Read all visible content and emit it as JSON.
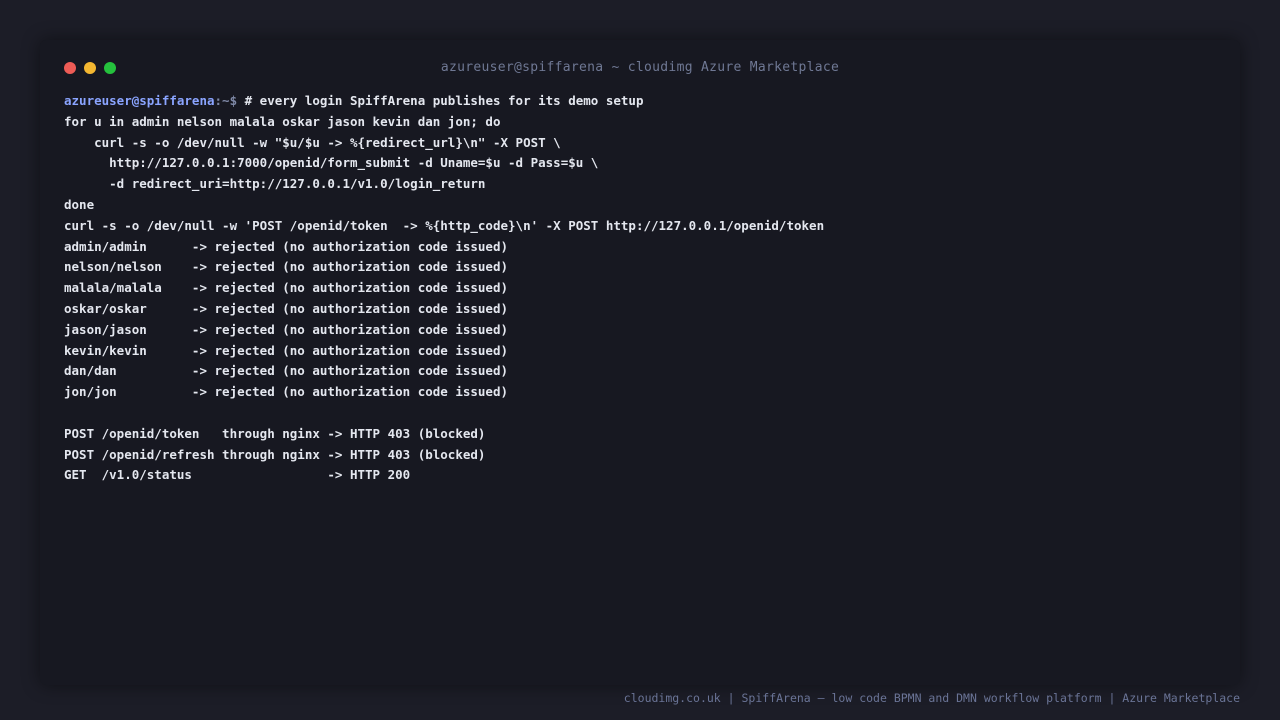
{
  "window": {
    "title": "azureuser@spiffarena ~ cloudimg Azure Marketplace",
    "controls": {
      "close_color": "#ee5c56",
      "minimize_color": "#f4b731",
      "maximize_color": "#25c13d"
    }
  },
  "terminal": {
    "prompt_user": "azureuser@spiffarena",
    "prompt_path": ":~$",
    "prompt_command": " # every login SpiffArena publishes for its demo setup",
    "lines": [
      "for u in admin nelson malala oskar jason kevin dan jon; do",
      "    curl -s -o /dev/null -w \"$u/$u -> %{redirect_url}\\n\" -X POST \\",
      "      http://127.0.0.1:7000/openid/form_submit -d Uname=$u -d Pass=$u \\",
      "      -d redirect_uri=http://127.0.0.1/v1.0/login_return",
      "done",
      "curl -s -o /dev/null -w 'POST /openid/token  -> %{http_code}\\n' -X POST http://127.0.0.1/openid/token",
      "admin/admin      -> rejected (no authorization code issued)",
      "nelson/nelson    -> rejected (no authorization code issued)",
      "malala/malala    -> rejected (no authorization code issued)",
      "oskar/oskar      -> rejected (no authorization code issued)",
      "jason/jason      -> rejected (no authorization code issued)",
      "kevin/kevin      -> rejected (no authorization code issued)",
      "dan/dan          -> rejected (no authorization code issued)",
      "jon/jon          -> rejected (no authorization code issued)",
      "",
      "POST /openid/token   through nginx -> HTTP 403 (blocked)",
      "POST /openid/refresh through nginx -> HTTP 403 (blocked)",
      "GET  /v1.0/status                  -> HTTP 200"
    ]
  },
  "footer": {
    "text": "cloudimg.co.uk | SpiffArena — low code BPMN and DMN workflow platform | Azure Marketplace"
  }
}
